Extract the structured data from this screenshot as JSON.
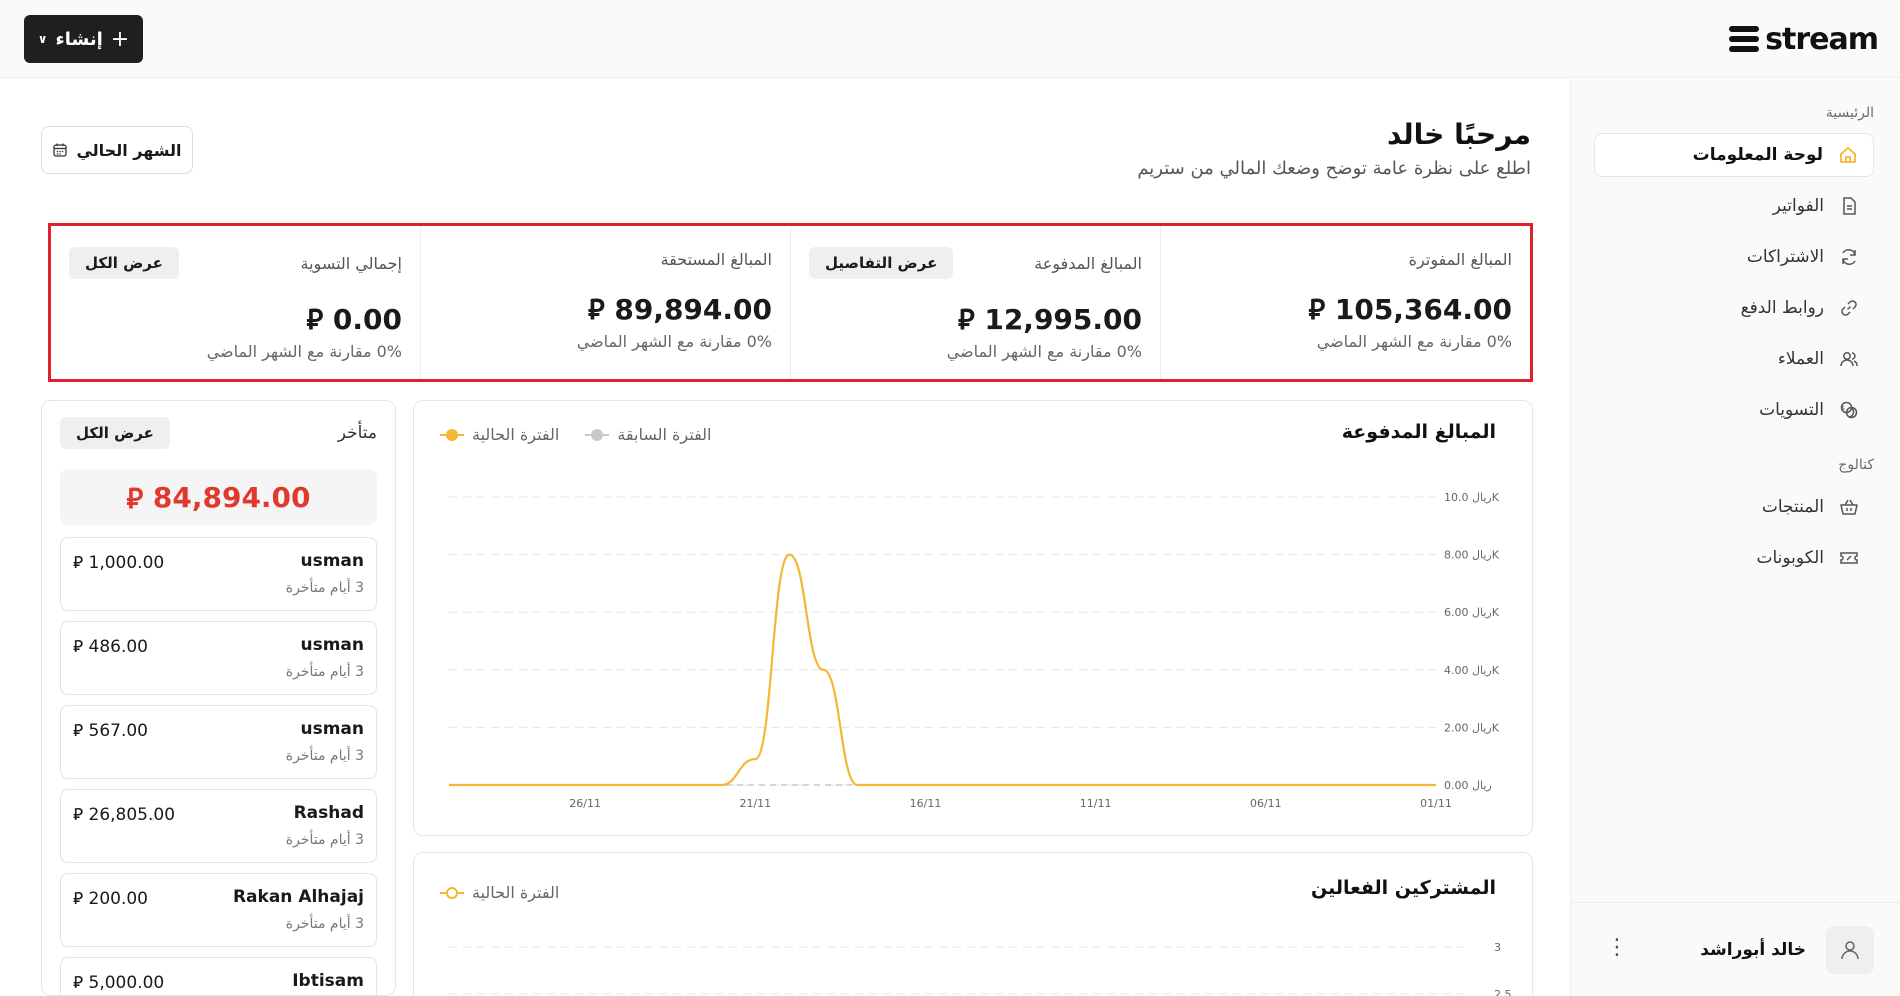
{
  "topbar": {
    "create_label": "إنشاء",
    "logo_text": "stream"
  },
  "sidebar": {
    "section_main": "الرئيسية",
    "section_catalog": "كتالوج",
    "items": [
      {
        "label": "لوحة المعلومات",
        "icon": "home-icon",
        "active": true
      },
      {
        "label": "الفواتير",
        "icon": "document-icon"
      },
      {
        "label": "الاشتراكات",
        "icon": "refresh-icon"
      },
      {
        "label": "روابط الدفع",
        "icon": "link-icon"
      },
      {
        "label": "العملاء",
        "icon": "users-icon"
      },
      {
        "label": "التسويات",
        "icon": "coins-icon"
      }
    ],
    "catalog_items": [
      {
        "label": "المنتجات",
        "icon": "basket-icon"
      },
      {
        "label": "الكوبونات",
        "icon": "ticket-icon"
      }
    ],
    "user_name": "خالد أبوراشد"
  },
  "header": {
    "title": "مرحبًا خالد",
    "subtitle": "اطلع على نظرة عامة توضح وضعك المالي من ستريم",
    "month_button": "الشهر الحالي"
  },
  "stats": [
    {
      "label": "المبالغ المفوترة",
      "value": "105,364.00",
      "comparison": "0% مقارنة مع الشهر الماضي",
      "action": ""
    },
    {
      "label": "المبالغ المدفوعة",
      "value": "12,995.00",
      "comparison": "0% مقارنة مع الشهر الماضي",
      "action": "عرض التفاصيل"
    },
    {
      "label": "المبالغ المستحقة",
      "value": "89,894.00",
      "comparison": "0% مقارنة مع الشهر الماضي",
      "action": ""
    },
    {
      "label": "إجمالي التسوية",
      "value": "0.00",
      "comparison": "0% مقارنة مع الشهر الماضي",
      "action": "عرض الكل"
    }
  ],
  "currency_symbol": "⃁",
  "overdue": {
    "title": "متأخر",
    "view_all": "عرض الكل",
    "total": "84,894.00",
    "rows": [
      {
        "name": "usman",
        "amount": "1,000.00",
        "late": "3 أيام متأخرة"
      },
      {
        "name": "usman",
        "amount": "486.00",
        "late": "3 أيام متأخرة"
      },
      {
        "name": "usman",
        "amount": "567.00",
        "late": "3 أيام متأخرة"
      },
      {
        "name": "Rashad",
        "amount": "26,805.00",
        "late": "3 أيام متأخرة"
      },
      {
        "name": "Rakan Alhajaj",
        "amount": "200.00",
        "late": "3 أيام متأخرة"
      },
      {
        "name": "Ibtisam",
        "amount": "5,000.00",
        "late": ""
      }
    ]
  },
  "charts": {
    "paid": {
      "title": "المبالغ المدفوعة",
      "legend_previous": "الفترة السابقة",
      "legend_current": "الفترة الحالية"
    },
    "subscribers": {
      "title": "المشتركين الفعالين",
      "legend_current": "الفترة الحالية"
    }
  },
  "colors": {
    "accent": "#f5b731",
    "previous": "#c8c8c8",
    "alert": "#e03a2e",
    "highlight_border": "#e0202a"
  },
  "chart_data": [
    {
      "type": "line",
      "title": "المبالغ المدفوعة",
      "x_ticks": [
        "01/11",
        "06/11",
        "11/11",
        "16/11",
        "21/11",
        "26/11"
      ],
      "y_ticks": [
        "ريال 0.00",
        "ريال 2.00K",
        "ريال 4.00K",
        "ريال 6.00K",
        "ريال 8.00K",
        "ريال 10.0K"
      ],
      "ylim": [
        0,
        10000
      ],
      "x": [
        "01/11",
        "02/11",
        "03/11",
        "04/11",
        "05/11",
        "06/11",
        "07/11",
        "08/11",
        "09/11",
        "10/11",
        "11/11",
        "12/11",
        "13/11",
        "14/11",
        "15/11",
        "16/11",
        "17/11",
        "18/11",
        "19/11",
        "20/11",
        "21/11",
        "22/11",
        "23/11",
        "24/11",
        "25/11",
        "26/11",
        "27/11",
        "28/11",
        "29/11",
        "30/11"
      ],
      "series": [
        {
          "name": "الفترة الحالية",
          "values": [
            0,
            0,
            0,
            0,
            0,
            0,
            0,
            0,
            0,
            0,
            0,
            0,
            0,
            0,
            0,
            0,
            0,
            0,
            4000,
            8000,
            900,
            0,
            0,
            0,
            0,
            0,
            0,
            0,
            0,
            0
          ]
        },
        {
          "name": "الفترة السابقة",
          "values": [
            0,
            0,
            0,
            0,
            0,
            0,
            0,
            0,
            0,
            0,
            0,
            0,
            0,
            0,
            0,
            0,
            0,
            0,
            0,
            0,
            0,
            0,
            0,
            0,
            0,
            0,
            0,
            0,
            0,
            0
          ]
        }
      ],
      "grid": true,
      "legend": "top-left"
    },
    {
      "type": "line",
      "title": "المشتركين الفعالين",
      "y_ticks": [
        "3",
        "2.5"
      ],
      "series": [
        {
          "name": "الفترة الحالية",
          "values": []
        }
      ],
      "legend": "top-left"
    }
  ]
}
